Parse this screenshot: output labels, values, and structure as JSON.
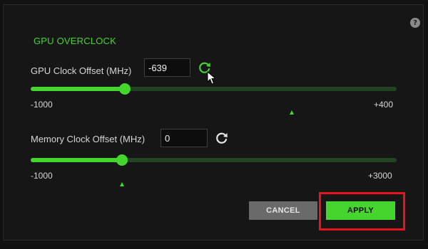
{
  "dialog": {
    "title": "GPU OVERCLOCK",
    "help_icon": "question-icon",
    "help_symbol": "?"
  },
  "gpu_clock": {
    "label": "GPU Clock Offset (MHz)",
    "value": "-639",
    "min_label": "-1000",
    "max_label": "+400",
    "min": -1000,
    "max": 400,
    "current": -639,
    "marker_value": 0,
    "reset_icon": "refresh-icon",
    "reset_color": "#44d62c"
  },
  "memory_clock": {
    "label": "Memory Clock Offset (MHz)",
    "value": "0",
    "min_label": "-1000",
    "max_label": "+3000",
    "min": -1000,
    "max": 3000,
    "current": 0,
    "marker_value": 0,
    "reset_icon": "refresh-icon",
    "reset_color": "#e6e6e6"
  },
  "buttons": {
    "cancel_label": "CANCEL",
    "apply_label": "APPLY"
  },
  "colors": {
    "accent": "#44d62c",
    "highlight": "#e8141d",
    "background": "#161616"
  }
}
